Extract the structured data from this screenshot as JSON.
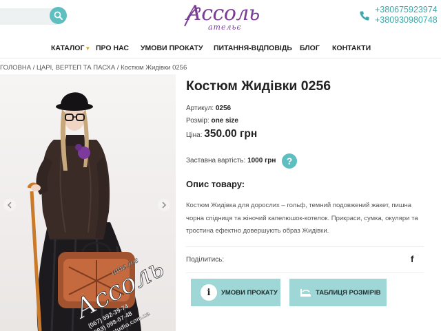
{
  "header": {
    "search_placeholder": "",
    "logo_text": "Ассоль",
    "logo_sub": "ательє",
    "phones": [
      "+380675923974",
      "+380930980748"
    ]
  },
  "nav": {
    "items": [
      "КАТАЛОГ",
      "ПРО НАС",
      "УМОВИ ПРОКАТУ",
      "ПИТАННЯ-ВІДПОВІДЬ",
      "БЛОГ",
      "КОНТАКТИ"
    ]
  },
  "breadcrumb": {
    "text": "ГОЛОВНА / ЦАРІ, ВЕРТЕП ТА ПАСХА / Костюм Жидівки 0256"
  },
  "photo": {
    "watermark_brand": "Ассоль",
    "watermark_sub": "ательє",
    "watermark_phone1": "(067) 592-39-74",
    "watermark_phone2": "(093) 098-07-48",
    "watermark_site": "assol-studio.com.ua"
  },
  "product": {
    "title": "Костюм Жидівки 0256",
    "article_label": "Артикул:",
    "article_value": "0256",
    "size_label": "Розмір:",
    "size_value": "one size",
    "price_label": "Ціна:",
    "price_value": "350.00 грн",
    "deposit_label": "Заставна вартість:",
    "deposit_value": "1000 грн",
    "help_symbol": "?",
    "desc_heading": "Опис товару:",
    "description": "Костюм Жидівка для дорослих – гольф, темний подовжений жакет, пишна чорна спідниця та жіночий капелюшок-котелок. Прикраси, сумка, окуляри та тростина ефектно довершують образ Жидівки.",
    "share_label": "Поділитись:",
    "facebook_glyph": "f"
  },
  "buttons": {
    "rent_icon_glyph": "i",
    "rent": "УМОВИ ПРОКАТУ",
    "sizes": "ТАБЛИЦЯ РОЗМІРІВ"
  },
  "colors": {
    "accent": "#5fbfc0",
    "button_bg": "#9fd7d6",
    "logo": "#7a3d95",
    "phone": "#3aa9ab",
    "caret": "#d6a52b"
  }
}
